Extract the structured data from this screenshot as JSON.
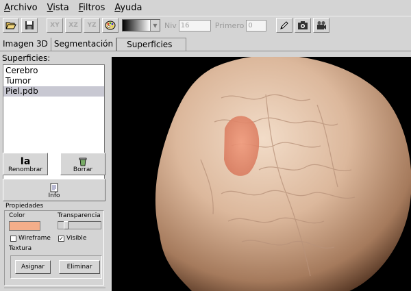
{
  "menu": {
    "items": [
      {
        "first": "A",
        "rest": "rchivo"
      },
      {
        "first": "V",
        "rest": "ista"
      },
      {
        "first": "F",
        "rest": "iltros"
      },
      {
        "first": "A",
        "rest": "yuda"
      }
    ]
  },
  "toolbar": {
    "open_icon": "folder-open-icon",
    "save_icon": "floppy-disk-icon",
    "plane_xy": "XY",
    "plane_xz": "XZ",
    "plane_yz": "YZ",
    "palette_icon": "palette-icon",
    "niv_label": "Niv",
    "niv_value": "16",
    "primero_label": "Primero",
    "primero_value": "0",
    "pencil_icon": "pencil-icon",
    "snapshot_icon": "camera-icon",
    "film_icon": "film-camera-icon"
  },
  "tabs": [
    {
      "label": "Imagen 3D",
      "active": false
    },
    {
      "label": "Segmentación",
      "active": false
    },
    {
      "label": "Superficies",
      "active": true
    }
  ],
  "surfaces": {
    "label": "Superficies:",
    "items": [
      {
        "label": "Cerebro",
        "selected": false
      },
      {
        "label": "Tumor",
        "selected": false
      },
      {
        "label": "Piel.pdb",
        "selected": true
      }
    ],
    "rename_button": "Renombrar",
    "delete_button": "Borrar",
    "info_button": "Info"
  },
  "properties": {
    "title": "Propiedades",
    "color_label": "Color",
    "color_value": "#f4ae8a",
    "transparency_label": "Transparencia",
    "transparency_level": 0.15,
    "wireframe_label": "Wireframe",
    "wireframe_checked": false,
    "visible_label": "Visible",
    "visible_checked": true,
    "texture_label": "Textura",
    "assign_button": "Asignar",
    "remove_button": "Eliminar"
  },
  "colors": {
    "background": "#d4d4d4",
    "viewport": "#000000",
    "skin": "#d9b59a",
    "tumor": "#e8886a"
  }
}
